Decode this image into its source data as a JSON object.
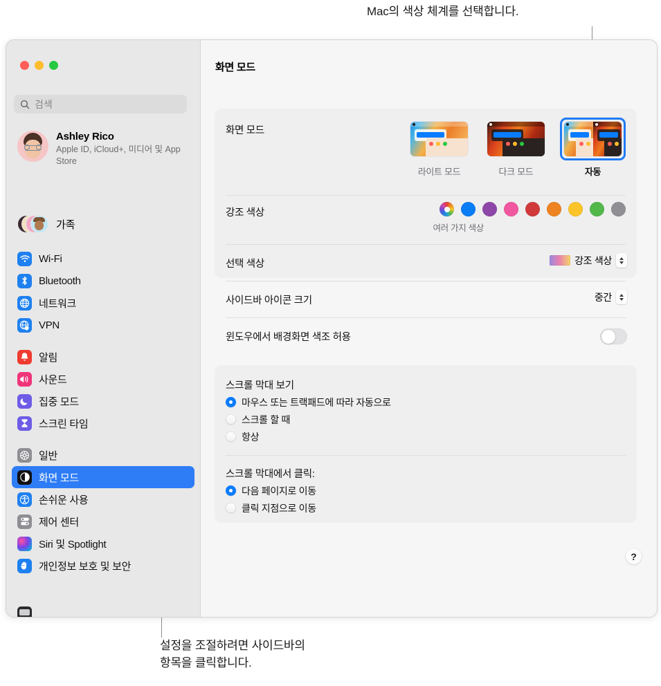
{
  "callouts": {
    "top": "Mac의 색상 체계를 선택합니다.",
    "bottom": "설정을 조절하려면 사이드바의\n항목을 클릭합니다."
  },
  "window": {
    "title": "화면 모드",
    "traffic_lights": [
      "close",
      "minimize",
      "zoom"
    ]
  },
  "sidebar": {
    "search": {
      "placeholder": "검색",
      "value": ""
    },
    "account": {
      "name": "Ashley Rico",
      "subtitle": "Apple ID, iCloud+, 미디어 및 App Store"
    },
    "family": {
      "label": "가족"
    },
    "groups": [
      {
        "items": [
          {
            "label": "Wi-Fi",
            "icon": "wifi-icon"
          },
          {
            "label": "Bluetooth",
            "icon": "bluetooth-icon"
          },
          {
            "label": "네트워크",
            "icon": "network-globe-icon"
          },
          {
            "label": "VPN",
            "icon": "vpn-globe-icon"
          }
        ]
      },
      {
        "items": [
          {
            "label": "알림",
            "icon": "notifications-bell-icon"
          },
          {
            "label": "사운드",
            "icon": "sound-speaker-icon"
          },
          {
            "label": "집중 모드",
            "icon": "focus-moon-icon"
          },
          {
            "label": "스크린 타임",
            "icon": "screen-time-hourglass-icon"
          }
        ]
      },
      {
        "items": [
          {
            "label": "일반",
            "icon": "general-gear-icon"
          },
          {
            "label": "화면 모드",
            "icon": "appearance-icon",
            "selected": true
          },
          {
            "label": "손쉬운 사용",
            "icon": "accessibility-icon"
          },
          {
            "label": "제어 센터",
            "icon": "control-center-icon"
          },
          {
            "label": "Siri 및 Spotlight",
            "icon": "siri-icon"
          },
          {
            "label": "개인정보 보호 및 보안",
            "icon": "privacy-hand-icon"
          }
        ]
      }
    ]
  },
  "main": {
    "appearance": {
      "label": "화면 모드",
      "modes": [
        {
          "label": "라이트 모드",
          "value": "light",
          "selected": false
        },
        {
          "label": "다크 모드",
          "value": "dark",
          "selected": false
        },
        {
          "label": "자동",
          "value": "auto",
          "selected": true
        }
      ]
    },
    "accent": {
      "label": "강조 색상",
      "caption": "여러 가지 색상",
      "swatches": [
        {
          "name": "multicolor",
          "color": "multi",
          "selected": true
        },
        {
          "name": "blue",
          "color": "#0a7cf5"
        },
        {
          "name": "purple",
          "color": "#8d47a8"
        },
        {
          "name": "pink",
          "color": "#f1589f"
        },
        {
          "name": "red",
          "color": "#d13a3a"
        },
        {
          "name": "orange",
          "color": "#ed8421"
        },
        {
          "name": "yellow",
          "color": "#fbc52a"
        },
        {
          "name": "green",
          "color": "#52b84a"
        },
        {
          "name": "graphite",
          "color": "#8f8f94"
        }
      ]
    },
    "highlight": {
      "label": "선택 색상",
      "value": "강조 색상"
    },
    "icon_size": {
      "label": "사이드바 아이콘 크기",
      "value": "중간"
    },
    "wallpaper_tinting": {
      "label": "윈도우에서 배경화면 색조 허용",
      "state": "off"
    },
    "scrollbar_show": {
      "title": "스크롤 막대 보기",
      "options": [
        {
          "label": "마우스 또는 트랙패드에 따라 자동으로",
          "selected": true
        },
        {
          "label": "스크롤 할 때",
          "selected": false
        },
        {
          "label": "항상",
          "selected": false
        }
      ]
    },
    "scrollbar_click": {
      "title": "스크롤 막대에서 클릭:",
      "options": [
        {
          "label": "다음 페이지로 이동",
          "selected": true
        },
        {
          "label": "클릭 지점으로 이동",
          "selected": false
        }
      ]
    },
    "help_label": "?"
  }
}
